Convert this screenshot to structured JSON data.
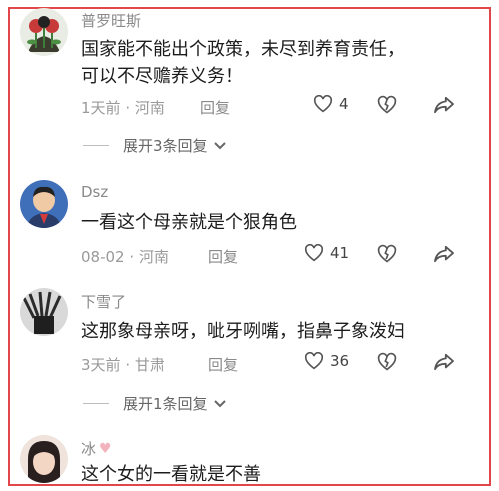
{
  "comments": [
    {
      "username": "普罗旺斯",
      "content_line1": "国家能不能出个政策，未尽到养育责任，",
      "content_line2": "可以不尽赡养义务！",
      "time": "1天前",
      "location": "河南",
      "reply_label": "回复",
      "likes": "4",
      "expand_label": "展开3条回复"
    },
    {
      "username": "Dsz",
      "content_line1": "一看这个母亲就是个狠角色",
      "time": "08-02",
      "location": "河南",
      "reply_label": "回复",
      "likes": "41"
    },
    {
      "username": "下雪了",
      "content_line1": "这那象母亲呀，呲牙咧嘴，指鼻子象泼妇",
      "time": "3天前",
      "location": "甘肃",
      "reply_label": "回复",
      "likes": "36",
      "expand_label": "展开1条回复"
    },
    {
      "username": "冰",
      "content_line1": "这个女的一看就是不善"
    }
  ],
  "meta_separator": "·",
  "colors": {
    "frame_border": "#e0464a",
    "username": "#8a8a8a",
    "heart_badge": "#f2b3bc"
  }
}
